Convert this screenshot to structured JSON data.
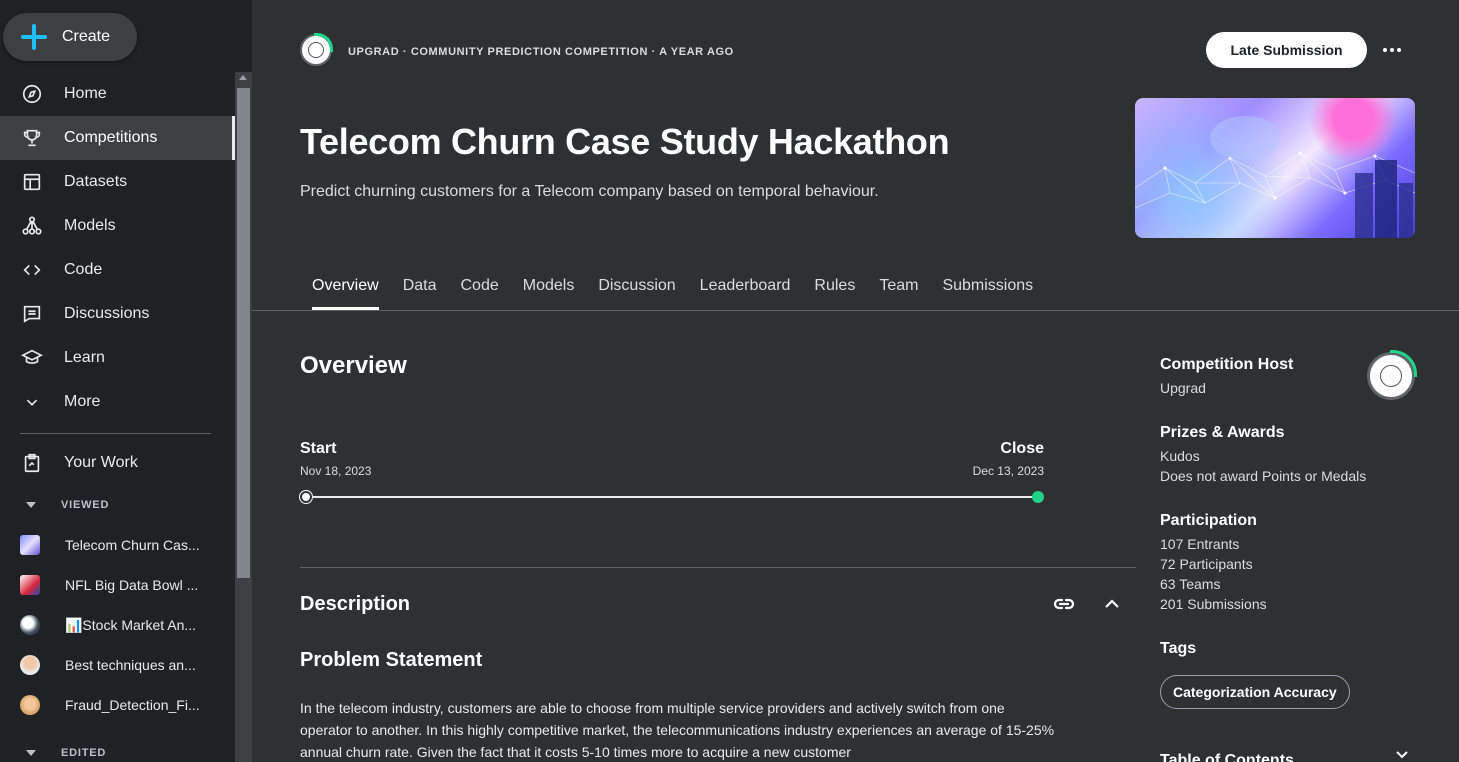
{
  "sidebar": {
    "create_label": "Create",
    "nav": [
      {
        "label": "Home",
        "icon": "compass-icon"
      },
      {
        "label": "Competitions",
        "icon": "trophy-icon",
        "active": true
      },
      {
        "label": "Datasets",
        "icon": "table-icon"
      },
      {
        "label": "Models",
        "icon": "models-icon"
      },
      {
        "label": "Code",
        "icon": "code-icon"
      },
      {
        "label": "Discussions",
        "icon": "discussion-icon"
      },
      {
        "label": "Learn",
        "icon": "graduation-cap-icon"
      },
      {
        "label": "More",
        "icon": "chevron-down-icon"
      }
    ],
    "your_work_label": "Your Work",
    "viewed_label": "VIEWED",
    "viewed": [
      "Telecom Churn Cas...",
      "NFL Big Data Bowl ...",
      "📊Stock Market An...",
      "Best techniques an...",
      "Fraud_Detection_Fi..."
    ],
    "edited_label": "EDITED"
  },
  "header": {
    "meta": "UPGRAD · COMMUNITY PREDICTION COMPETITION · A YEAR AGO",
    "late_submission": "Late Submission",
    "title": "Telecom Churn Case Study Hackathon",
    "subtitle": "Predict churning customers for a Telecom company based on temporal behaviour."
  },
  "tabs": [
    "Overview",
    "Data",
    "Code",
    "Models",
    "Discussion",
    "Leaderboard",
    "Rules",
    "Team",
    "Submissions"
  ],
  "overview": {
    "heading": "Overview",
    "start_label": "Start",
    "start_date": "Nov 18, 2023",
    "close_label": "Close",
    "close_date": "Dec 13, 2023",
    "description_heading": "Description",
    "problem_heading": "Problem Statement",
    "problem_text": "In the telecom industry, customers are able to choose from multiple service providers and actively switch from one operator to another. In this highly competitive market, the telecommunications industry experiences an average of 15-25% annual churn rate. Given the fact that it costs 5-10 times more to acquire a new customer"
  },
  "right": {
    "host_heading": "Competition Host",
    "host_name": "Upgrad",
    "prizes_heading": "Prizes & Awards",
    "prizes_line1": "Kudos",
    "prizes_line2": "Does not award Points or Medals",
    "participation_heading": "Participation",
    "entrants": "107 Entrants",
    "participants": "72 Participants",
    "teams": "63 Teams",
    "submissions": "201 Submissions",
    "tags_heading": "Tags",
    "tag": "Categorization Accuracy",
    "toc": "Table of Contents"
  }
}
